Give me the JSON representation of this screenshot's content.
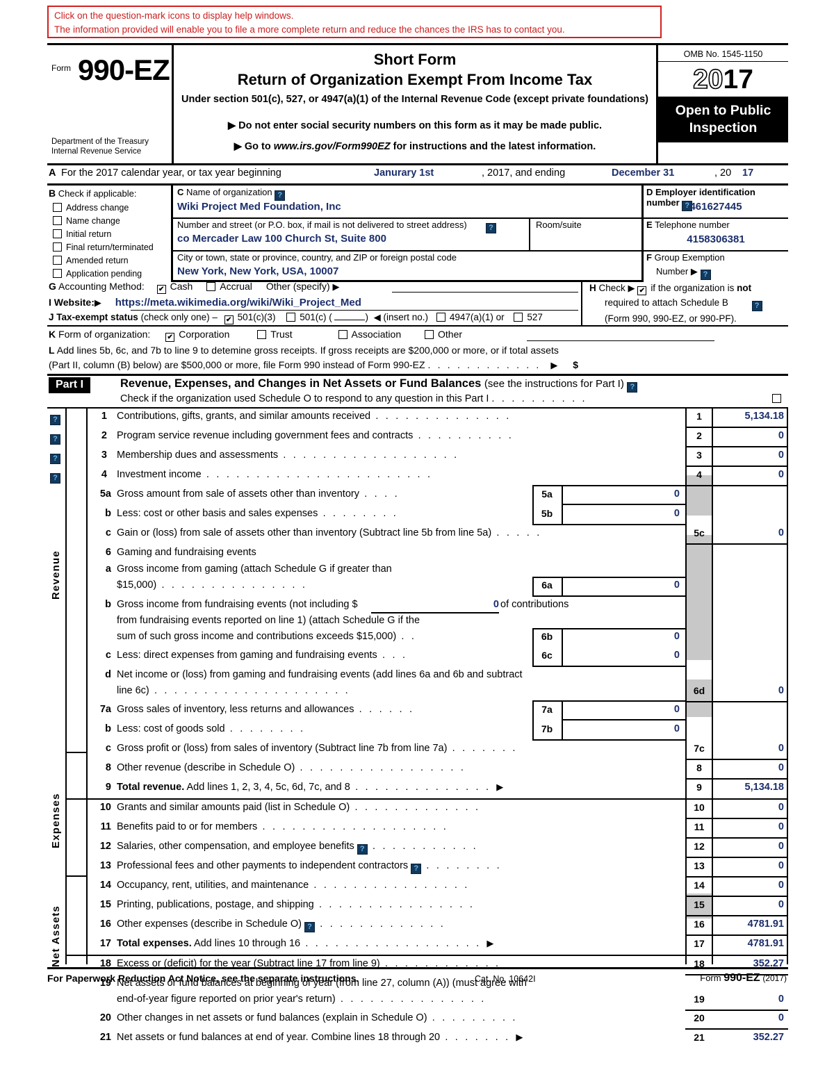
{
  "help_banner": {
    "line1": "Click on the question-mark icons to display help windows.",
    "line2": "The information provided will enable you to file a more complete return and reduce the chances the IRS has to contact you.",
    "border_color": "#d32020",
    "text_color": "#cc2020"
  },
  "header": {
    "form_label": "Form",
    "form_number": "990-EZ",
    "department_line1": "Department of the Treasury",
    "department_line2": "Internal Revenue Service",
    "title_line1": "Short Form",
    "title_line2": "Return of Organization Exempt From Income Tax",
    "subtitle": "Under section 501(c), 527, or 4947(a)(1) of the Internal Revenue Code (except private foundations)",
    "bullet1": "▶ Do not enter social security numbers on this form as it may be made public.",
    "bullet2_pre": "▶ Go to ",
    "bullet2_link": "www.irs.gov/Form990EZ",
    "bullet2_post": " for instructions and the latest information.",
    "omb": "OMB No. 1545-1150",
    "year_outline": "20",
    "year_solid": "17",
    "open_line1": "Open to Public",
    "open_line2": "Inspection"
  },
  "section_a": {
    "label": "A",
    "text": "For the 2017 calendar year, or tax year beginning",
    "begin_value": "Janurary 1st",
    "mid_text": ", 2017, and ending",
    "end_value": "December 31",
    "year_prefix": ", 20",
    "year_value": "17"
  },
  "section_b": {
    "label": "B",
    "title": "Check if applicable:",
    "items": [
      {
        "label": "Address change",
        "checked": false
      },
      {
        "label": "Name change",
        "checked": false
      },
      {
        "label": "Initial return",
        "checked": false
      },
      {
        "label": "Final return/terminated",
        "checked": false
      },
      {
        "label": "Amended return",
        "checked": false
      },
      {
        "label": "Application pending",
        "checked": false
      }
    ]
  },
  "section_c": {
    "label": "C",
    "name_label": "Name of organization",
    "name_value": "Wiki Project Med Foundation, Inc",
    "street_label": "Number and street (or P.O. box, if mail is not delivered to street address)",
    "street_value": "co Mercader Law 100 Church St, Suite 800",
    "room_label": "Room/suite",
    "room_value": "",
    "city_label": "City or town, state or province, country, and ZIP or foreign postal code",
    "city_value": "New York, New York, USA, 10007"
  },
  "section_d": {
    "label": "D",
    "ein_label": "Employer identification number",
    "ein_value": "461627445",
    "phone_label_letter": "E",
    "phone_label": "Telephone number",
    "phone_value": "4158306381",
    "group_label_letter": "F",
    "group_label_line1": "Group Exemption",
    "group_label_line2": "Number",
    "group_value": ""
  },
  "section_g": {
    "label": "G",
    "title": "Accounting Method:",
    "cash_label": "Cash",
    "cash_checked": true,
    "accrual_label": "Accrual",
    "accrual_checked": false,
    "other_label": "Other (specify)",
    "other_value": ""
  },
  "section_i": {
    "label": "I",
    "title": "Website:",
    "url": "https://meta.wikimedia.org/wiki/Wiki_Project_Med"
  },
  "section_j": {
    "label": "J",
    "title": "Tax-exempt status",
    "note": "(check only one) –",
    "opt1": "501(c)(3)",
    "opt1_checked": true,
    "opt2": "501(c) (",
    "opt2_checked": false,
    "opt2_close": ")",
    "insert": "(insert no.)",
    "opt3": "4947(a)(1) or",
    "opt3_checked": false,
    "opt4": "527",
    "opt4_checked": false
  },
  "section_h": {
    "label": "H",
    "line1_pre": "Check",
    "line1_post_a": "if the organization is ",
    "line1_post_b": "not",
    "line2": "required to attach Schedule B",
    "line3": "(Form 990, 990-EZ, or 990-PF).",
    "checked": true
  },
  "section_k": {
    "label": "K",
    "title": "Form of organization:",
    "options": [
      {
        "label": "Corporation",
        "checked": true
      },
      {
        "label": "Trust",
        "checked": false
      },
      {
        "label": "Association",
        "checked": false
      },
      {
        "label": "Other",
        "checked": false
      }
    ]
  },
  "section_l": {
    "label": "L",
    "line1": "Add lines 5b, 6c, and 7b to line 9 to detemine gross receipts. If gross receipts are $200,000 or more, or if total assets",
    "line2": "(Part II, column (B) below) are $500,000 or more, file Form 990 instead of Form 990-EZ",
    "dollar": "$",
    "value": ""
  },
  "part1": {
    "tag": "Part I",
    "title_bold": "Revenue, Expenses, and Changes in Net Assets or Fund Balances",
    "title_reg": "(see the instructions for Part I)",
    "sub": "Check if the organization used Schedule O to respond to any question in this Part I",
    "sub_checked": false
  },
  "side_labels": {
    "revenue": "Revenue",
    "expenses": "Expenses",
    "net_assets": "Net Assets"
  },
  "lines": [
    {
      "no": "1",
      "text": "Contributions, gifts, grants, and similar amounts received",
      "box": "1",
      "amount": "5,134.18",
      "help": true
    },
    {
      "no": "2",
      "text": "Program service revenue including government fees and contracts",
      "box": "2",
      "amount": "0",
      "help": true
    },
    {
      "no": "3",
      "text": "Membership dues and assessments",
      "box": "3",
      "amount": "0",
      "help": true
    },
    {
      "no": "4",
      "text": "Investment income",
      "box": "4",
      "amount": "0",
      "help": true
    },
    {
      "no": "5a",
      "text": "Gross amount from sale of assets other than inventory",
      "inner_box": "5a",
      "inner_amount": "0"
    },
    {
      "no": "b",
      "text": "Less: cost or other basis and sales expenses",
      "inner_box": "5b",
      "inner_amount": "0"
    },
    {
      "no": "c",
      "text": "Gain or (loss) from sale of assets other than inventory (Subtract line 5b from line 5a)",
      "box": "5c",
      "amount": "0"
    },
    {
      "no": "6",
      "text": "Gaming and fundraising events"
    },
    {
      "no": "a",
      "text": "Gross income from gaming (attach Schedule G if greater than",
      "text2": "$15,000)",
      "inner_box": "6a",
      "inner_amount": "0"
    },
    {
      "no": "b",
      "text": "Gross income from fundraising events (not including $",
      "inline_amount": "0",
      "text_after": "of contributions",
      "text2": "from fundraising events reported on line 1) (attach Schedule G if the",
      "text3": "sum of such gross income and contributions exceeds $15,000)",
      "inner_box": "6b",
      "inner_amount": "0"
    },
    {
      "no": "c",
      "text": "Less: direct expenses from gaming and fundraising events",
      "inner_box": "6c",
      "inner_amount": "0"
    },
    {
      "no": "d",
      "text": "Net income or (loss) from gaming and fundraising events (add lines 6a and 6b and subtract",
      "text2": "line 6c)",
      "box": "6d",
      "amount": "0"
    },
    {
      "no": "7a",
      "text": "Gross sales of inventory, less returns and allowances",
      "inner_box": "7a",
      "inner_amount": "0"
    },
    {
      "no": "b",
      "text": "Less: cost of goods sold",
      "inner_box": "7b",
      "inner_amount": "0"
    },
    {
      "no": "c",
      "text": "Gross profit or (loss) from sales of inventory (Subtract line 7b from line 7a)",
      "box": "7c",
      "amount": "0"
    },
    {
      "no": "8",
      "text": "Other revenue (describe in Schedule O)",
      "box": "8",
      "amount": "0"
    },
    {
      "no": "9",
      "text_bold": "Total revenue.",
      "text": " Add lines 1, 2, 3, 4, 5c, 6d, 7c, and 8",
      "box": "9",
      "amount": "5,134.18"
    },
    {
      "no": "10",
      "text": "Grants and similar amounts paid (list in Schedule O)",
      "box": "10",
      "amount": "0"
    },
    {
      "no": "11",
      "text": "Benefits paid to or for members",
      "box": "11",
      "amount": "0"
    },
    {
      "no": "12",
      "text": "Salaries, other compensation, and employee benefits",
      "help_inline": true,
      "box": "12",
      "amount": "0"
    },
    {
      "no": "13",
      "text": "Professional fees and other payments to independent contractors",
      "help_inline": true,
      "box": "13",
      "amount": "0"
    },
    {
      "no": "14",
      "text": "Occupancy, rent, utilities, and maintenance",
      "box": "14",
      "amount": "0"
    },
    {
      "no": "15",
      "text": "Printing, publications, postage, and shipping",
      "box": "15",
      "amount": "0"
    },
    {
      "no": "16",
      "text": "Other expenses (describe in Schedule O)",
      "help_inline": true,
      "box": "16",
      "amount": "4781.91"
    },
    {
      "no": "17",
      "text_bold": "Total expenses.",
      "text": " Add lines 10 through 16",
      "box": "17",
      "amount": "4781.91"
    },
    {
      "no": "18",
      "text": "Excess or (deficit) for the year (Subtract line 17 from line 9)",
      "box": "18",
      "amount": "352.27"
    },
    {
      "no": "19",
      "text": "Net assets or fund balances at beginning of year (from line 27, column (A)) (must agree with",
      "text2": "end-of-year figure reported on prior year's return)",
      "box": "19",
      "amount": "0"
    },
    {
      "no": "20",
      "text": "Other changes in net assets or fund balances (explain in Schedule O)",
      "box": "20",
      "amount": "0"
    },
    {
      "no": "21",
      "text": "Net assets or fund balances at end of year. Combine lines 18 through 20",
      "box": "21",
      "amount": "352.27"
    }
  ],
  "footer": {
    "left": "For Paperwork Reduction Act Notice, see the separate instructions.",
    "cat": "Cat. No. 10642I",
    "form_label": "Form",
    "form_number": "990-EZ",
    "year": "(2017)"
  },
  "icons": {
    "help": "help-question-icon",
    "check": "checkmark-icon",
    "arrow": "right-arrow-icon"
  }
}
